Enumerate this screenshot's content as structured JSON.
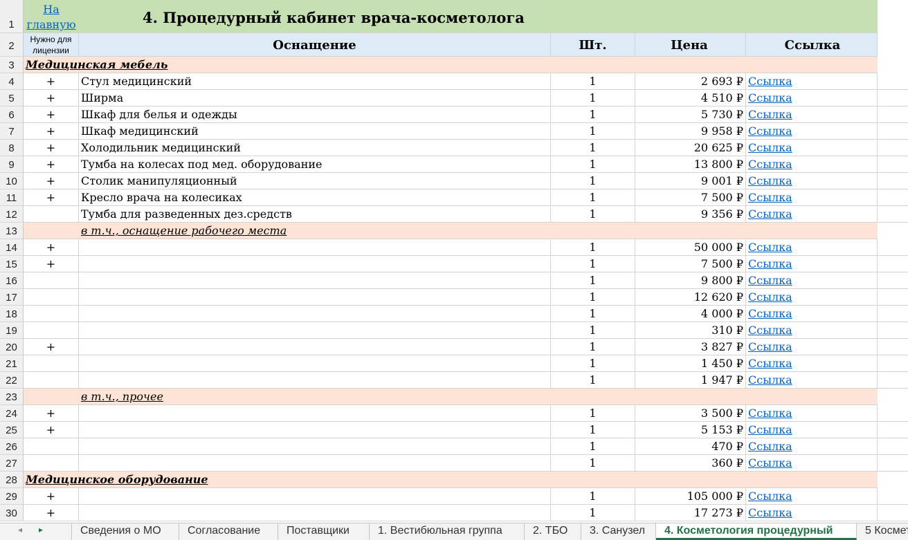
{
  "sheet": {
    "home_link_line1": "На",
    "home_link_line2": "главную",
    "title": "4. Процедурный кабинет врача-косметолога",
    "headers": {
      "needed_line1": "Нужно для",
      "needed_line2": "лицензии",
      "equipment": "Оснащение",
      "qty": "Шт.",
      "price": "Цена",
      "link": "Ссылка"
    },
    "row_numbers": [
      "1",
      "2",
      "3",
      "4",
      "5",
      "6",
      "7",
      "8",
      "9",
      "10",
      "11",
      "12",
      "13",
      "14",
      "15",
      "16",
      "17",
      "18",
      "19",
      "20",
      "21",
      "22",
      "23",
      "24",
      "25",
      "26",
      "27",
      "28",
      "29",
      "30"
    ],
    "rows": [
      {
        "type": "category",
        "text": "Медицинская мебель"
      },
      {
        "type": "item",
        "needed": "+",
        "name": "Стул медицинский",
        "qty": "1",
        "price": "2 693 ₽",
        "link": "Ссылка"
      },
      {
        "type": "item",
        "needed": "+",
        "name": "Ширма",
        "qty": "1",
        "price": "4 510 ₽",
        "link": "Ссылка"
      },
      {
        "type": "item",
        "needed": "+",
        "name": "Шкаф для белья и одежды",
        "qty": "1",
        "price": "5 730 ₽",
        "link": "Ссылка"
      },
      {
        "type": "item",
        "needed": "+",
        "name": "Шкаф медицинский",
        "qty": "1",
        "price": "9 958 ₽",
        "link": "Ссылка"
      },
      {
        "type": "item",
        "needed": "+",
        "name": "Холодильник медицинский",
        "qty": "1",
        "price": "20 625 ₽",
        "link": "Ссылка"
      },
      {
        "type": "item",
        "needed": "+",
        "name": "Тумба на колесах под мед. оборудование",
        "qty": "1",
        "price": "13 800 ₽",
        "link": "Ссылка"
      },
      {
        "type": "item",
        "needed": "+",
        "name": "Столик манипуляционный",
        "qty": "1",
        "price": "9 001 ₽",
        "link": "Ссылка"
      },
      {
        "type": "item",
        "needed": "+",
        "name": "Кресло врача на колесиках",
        "qty": "1",
        "price": "7 500 ₽",
        "link": "Ссылка"
      },
      {
        "type": "item",
        "needed": "",
        "name": "Тумба для разведенных дез.средств",
        "qty": "1",
        "price": "9 356 ₽",
        "link": "Ссылка"
      },
      {
        "type": "subcategory",
        "text": "в т.ч., оснащение рабочего места"
      },
      {
        "type": "item",
        "needed": "+",
        "name": "",
        "qty": "1",
        "price": "50 000 ₽",
        "link": "Ссылка"
      },
      {
        "type": "item",
        "needed": "+",
        "name": "",
        "qty": "1",
        "price": "7 500 ₽",
        "link": "Ссылка"
      },
      {
        "type": "item",
        "needed": "",
        "name": "",
        "qty": "1",
        "price": "9 800 ₽",
        "link": "Ссылка"
      },
      {
        "type": "item",
        "needed": "",
        "name": "",
        "qty": "1",
        "price": "12 620 ₽",
        "link": "Ссылка"
      },
      {
        "type": "item",
        "needed": "",
        "name": "",
        "qty": "1",
        "price": "4 000 ₽",
        "link": "Ссылка"
      },
      {
        "type": "item",
        "needed": "",
        "name": "",
        "qty": "1",
        "price": "310 ₽",
        "link": "Ссылка"
      },
      {
        "type": "item",
        "needed": "+",
        "name": "",
        "qty": "1",
        "price": "3 827 ₽",
        "link": "Ссылка"
      },
      {
        "type": "item",
        "needed": "",
        "name": "",
        "qty": "1",
        "price": "1 450 ₽",
        "link": "Ссылка"
      },
      {
        "type": "item",
        "needed": "",
        "name": "",
        "qty": "1",
        "price": "1 947 ₽",
        "link": "Ссылка"
      },
      {
        "type": "subcategory",
        "text": "в т.ч., прочее"
      },
      {
        "type": "item",
        "needed": "+",
        "name": "",
        "qty": "1",
        "price": "3 500 ₽",
        "link": "Ссылка"
      },
      {
        "type": "item",
        "needed": "+",
        "name": "",
        "qty": "1",
        "price": "5 153 ₽",
        "link": "Ссылка"
      },
      {
        "type": "item",
        "needed": "",
        "name": "",
        "qty": "1",
        "price": "470 ₽",
        "link": "Ссылка"
      },
      {
        "type": "item",
        "needed": "",
        "name": "",
        "qty": "1",
        "price": "360 ₽",
        "link": "Ссылка"
      },
      {
        "type": "category",
        "text": "Медицинское оборудование"
      },
      {
        "type": "item",
        "needed": "+",
        "name": "",
        "qty": "1",
        "price": "105 000 ₽",
        "link": "Ссылка"
      },
      {
        "type": "item",
        "needed": "+",
        "name": "",
        "qty": "1",
        "price": "17 273 ₽",
        "link": "Ссылка"
      }
    ]
  },
  "tabs": {
    "nav_prev_icon": "◂",
    "nav_next_icon": "▸",
    "items": [
      {
        "label": "Сведения о МО",
        "active": false
      },
      {
        "label": "Согласование",
        "active": false
      },
      {
        "label": "Поставщики",
        "active": false
      },
      {
        "label": "1. Вестибюльная группа",
        "active": false
      },
      {
        "label": "2. ТБО",
        "active": false
      },
      {
        "label": "3. Санузел",
        "active": false
      },
      {
        "label": "4. Косметология процедурный",
        "active": true
      },
      {
        "label": "5 Космет",
        "active": false
      }
    ]
  }
}
